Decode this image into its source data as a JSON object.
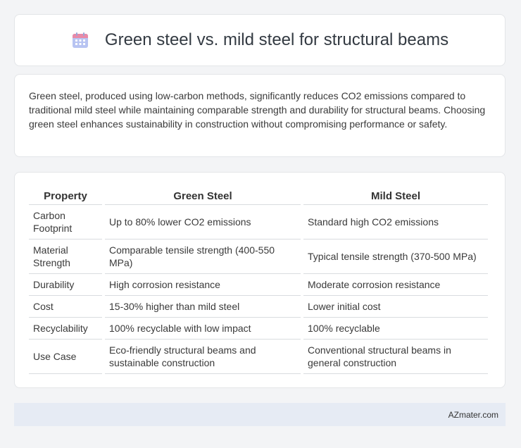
{
  "header": {
    "title": "Green steel vs. mild steel for structural beams",
    "icon": "calendar-icon"
  },
  "intro": {
    "text": "Green steel, produced using low-carbon methods, significantly reduces CO2 emissions compared to traditional mild steel while maintaining comparable strength and durability for structural beams. Choosing green steel enhances sustainability in construction without compromising performance or safety."
  },
  "table": {
    "headers": [
      "Property",
      "Green Steel",
      "Mild Steel"
    ],
    "rows": [
      [
        "Carbon Footprint",
        "Up to 80% lower CO2 emissions",
        "Standard high CO2 emissions"
      ],
      [
        "Material Strength",
        "Comparable tensile strength (400-550 MPa)",
        "Typical tensile strength (370-500 MPa)"
      ],
      [
        "Durability",
        "High corrosion resistance",
        "Moderate corrosion resistance"
      ],
      [
        "Cost",
        "15-30% higher than mild steel",
        "Lower initial cost"
      ],
      [
        "Recyclability",
        "100% recyclable with low impact",
        "100% recyclable"
      ],
      [
        "Use Case",
        "Eco-friendly structural beams and sustainable construction",
        "Conventional structural beams in general construction"
      ]
    ]
  },
  "footer": {
    "text": "AZmater.com"
  },
  "colors": {
    "background": "#f3f4f6",
    "card": "#ffffff",
    "footer_bg": "#e6ebf4",
    "icon_top": "#e57ca0",
    "icon_body": "#a9b8f0"
  }
}
